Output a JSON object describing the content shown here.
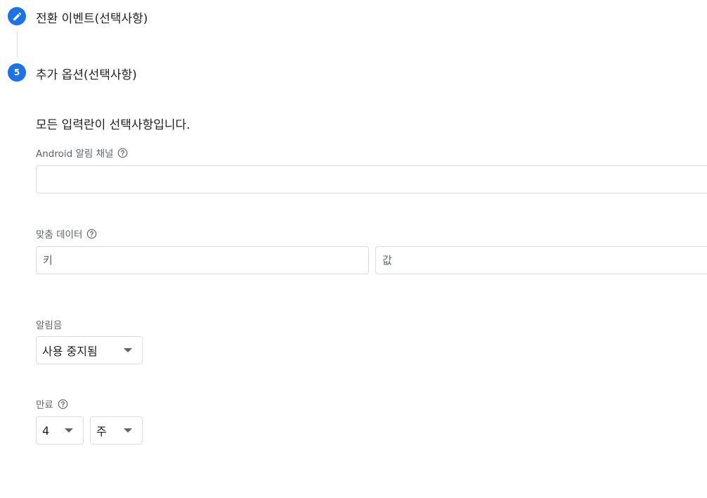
{
  "steps": [
    {
      "indicator": "edit-icon",
      "title": "전환 이벤트(선택사항)"
    },
    {
      "indicator": "5",
      "title": "추가 옵션(선택사항)"
    }
  ],
  "intro": "모든 입력란이 선택사항입니다.",
  "android_channel": {
    "label": "Android 알림 채널",
    "value": ""
  },
  "custom_data": {
    "label": "맞춤 데이터",
    "key_placeholder": "키",
    "value_placeholder": "값"
  },
  "sound": {
    "label": "알림음",
    "selected": "사용 중지됨"
  },
  "expiry": {
    "label": "만료",
    "amount": "4",
    "unit": "주"
  },
  "colors": {
    "accent": "#1a73e8",
    "border": "#dadce0",
    "label": "#5f6368"
  }
}
